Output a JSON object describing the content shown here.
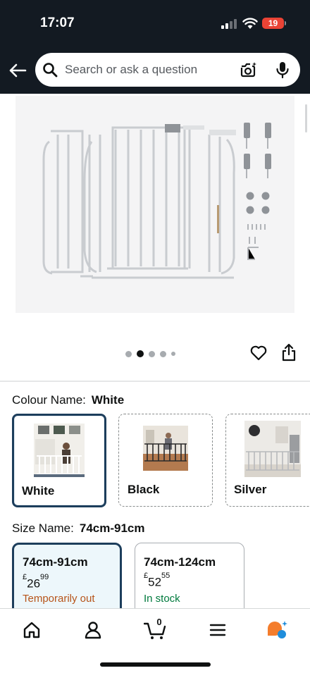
{
  "status_bar": {
    "time": "17:07",
    "battery": "19"
  },
  "search": {
    "placeholder": "Search or ask a question"
  },
  "icons": {
    "back": "back-arrow-icon",
    "search": "search-icon",
    "camera": "camera-search-icon",
    "mic": "microphone-icon",
    "heart": "heart-icon",
    "share": "share-icon"
  },
  "carousel": {
    "dots": 5,
    "active_index": 1
  },
  "colour": {
    "label": "Colour Name:",
    "selected": "White",
    "options": [
      {
        "label": "White"
      },
      {
        "label": "Black"
      },
      {
        "label": "Silver"
      }
    ]
  },
  "size": {
    "label": "Size Name:",
    "selected": "74cm-91cm",
    "options": [
      {
        "name": "74cm-91cm",
        "currency": "£",
        "price_whole": "26",
        "price_fraction": "99",
        "status": "Temporarily out"
      },
      {
        "name": "74cm-124cm",
        "currency": "£",
        "price_whole": "52",
        "price_fraction": "55",
        "status": "In stock"
      }
    ]
  },
  "bottom_nav": {
    "items": [
      "home-icon",
      "account-icon",
      "cart-icon",
      "menu-icon",
      "rufus-assistant-icon"
    ],
    "cart_count": "0"
  },
  "colors": {
    "header_bg": "#131a22",
    "selected_border": "#1d3e5c",
    "out_of_stock": "#b7541a",
    "in_stock": "#007a3d"
  }
}
